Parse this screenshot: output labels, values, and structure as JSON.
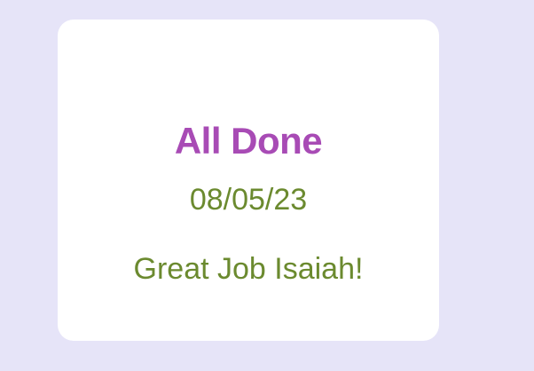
{
  "card": {
    "title": "All Done",
    "date": "08/05/23",
    "message": "Great Job Isaiah!"
  },
  "colors": {
    "background": "#e6e4f8",
    "card": "#ffffff",
    "title": "#a84bb5",
    "text": "#6b8a2f"
  }
}
